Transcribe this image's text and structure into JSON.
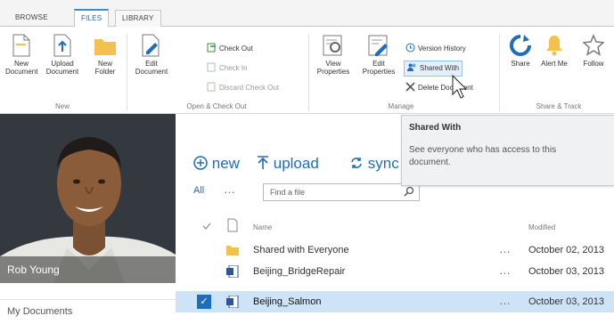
{
  "ribbon_tabs": [
    {
      "label": "BROWSE",
      "active": false
    },
    {
      "label": "FILES",
      "active": true
    },
    {
      "label": "LIBRARY",
      "active": false
    }
  ],
  "ribbon": {
    "new_group": {
      "label": "New",
      "new_document": "New Document",
      "upload_document": "Upload Document",
      "new_folder": "New Folder"
    },
    "open_checkout_group": {
      "label": "Open & Check Out",
      "edit_document": "Edit Document",
      "check_out": "Check Out",
      "check_in": "Check In",
      "discard_check_out": "Discard Check Out"
    },
    "manage_group": {
      "label": "Manage",
      "view_properties": "View Properties",
      "edit_properties": "Edit Properties",
      "version_history": "Version History",
      "shared_with": "Shared With",
      "delete_document": "Delete Document"
    },
    "share_track_group": {
      "label": "Share & Track",
      "share": "Share",
      "alert_me": "Alert Me",
      "follow": "Follow"
    }
  },
  "tooltip": {
    "title": "Shared With",
    "body": "See everyone who has access to this document."
  },
  "profile": {
    "name": "Rob Young",
    "nav_item": "My Documents"
  },
  "actions": {
    "new": "new",
    "upload": "upload",
    "sync": "sync"
  },
  "toolbar": {
    "view_all": "All",
    "more": "…",
    "search_placeholder": "Find a file"
  },
  "list": {
    "headers": {
      "name": "Name",
      "modified": "Modified"
    },
    "rows": [
      {
        "name": "Shared with Everyone",
        "type": "folder",
        "modified": "October 02, 2013",
        "selected": false
      },
      {
        "name": "Beijing_BridgeRepair",
        "type": "doc",
        "modified": "October 03, 2013",
        "selected": false
      },
      {
        "name": "Beijing_Salmon",
        "type": "doc",
        "modified": "October 03, 2013",
        "selected": true
      }
    ]
  },
  "colors": {
    "accent": "#1f6dbd",
    "selected_row": "#cfe3f7",
    "folder": "#f2c14e"
  }
}
